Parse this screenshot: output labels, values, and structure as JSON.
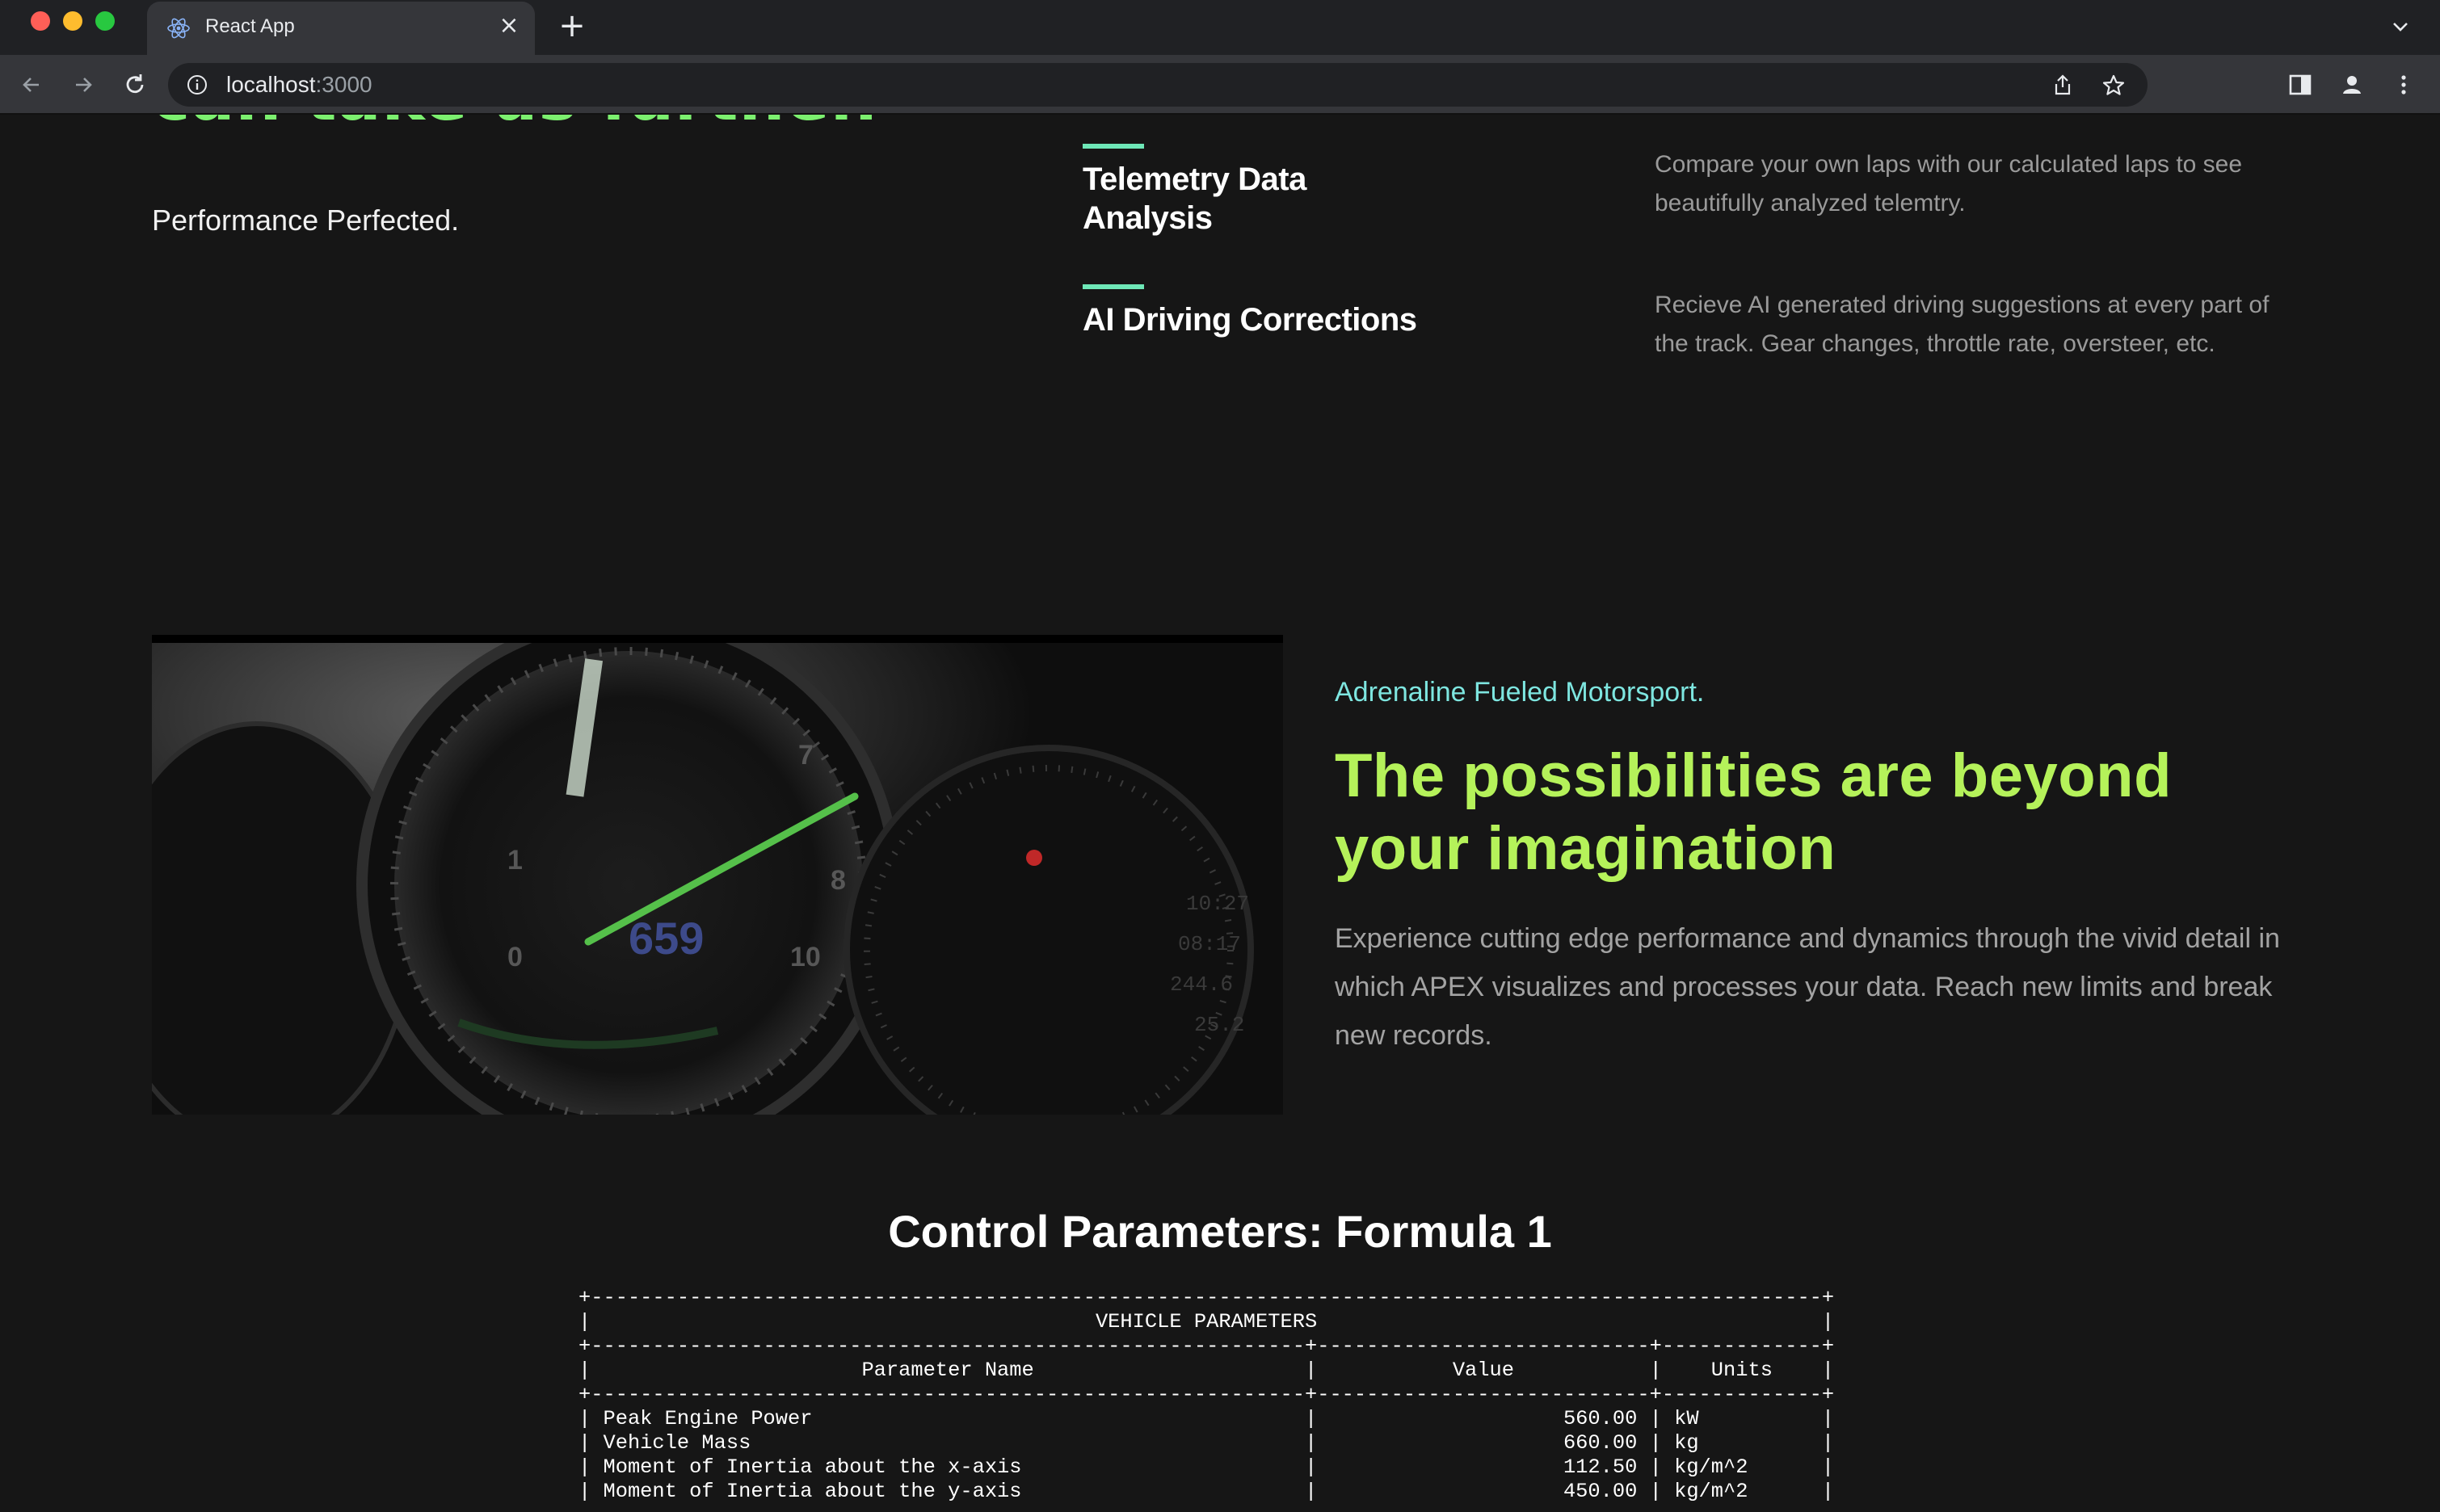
{
  "browser": {
    "tab_title": "React App",
    "url_host": "localhost",
    "url_port": ":3000",
    "icons": {
      "favicon": "react-logo-icon",
      "close": "close-icon",
      "new_tab": "plus-icon",
      "tab_menu": "chevron-down-icon",
      "back": "arrow-left-icon",
      "forward": "arrow-right-icon",
      "reload": "reload-icon",
      "site_info": "info-icon",
      "share": "share-icon",
      "bookmark": "star-icon",
      "side_panel": "side-panel-icon",
      "profile": "profile-icon",
      "menu": "kebab-menu-icon"
    }
  },
  "hero": {
    "cut_heading": "can take us farther.",
    "subtitle": "Performance Perfected."
  },
  "features": [
    {
      "title": "Telemetry Data Analysis",
      "description": "Compare your own laps with our calculated laps to see beautifully analyzed telemtry."
    },
    {
      "title": "AI Driving Corrections",
      "description": "Recieve AI generated driving suggestions at every part of the track. Gear changes, throttle rate, oversteer, etc."
    }
  ],
  "showcase": {
    "kicker": "Adrenaline Fueled Motorsport.",
    "headline": "The possibilities are beyond your imagination",
    "body": "Experience cutting edge performance and dynamics through the vivid detail in which APEX visualizes and processes your data. Reach new limits and break new records.",
    "video_alt": "dashboard-gauge-video"
  },
  "control_parameters": {
    "title": "Control Parameters: Formula 1",
    "table_title": "VEHICLE PARAMETERS",
    "headers": [
      "Parameter Name",
      "Value",
      "Units"
    ],
    "rows": [
      [
        "Peak Engine Power",
        "560.00",
        "kW"
      ],
      [
        "Vehicle Mass",
        "660.00",
        "kg"
      ],
      [
        "Moment of Inertia about the x-axis",
        "112.50",
        "kg/m^2"
      ],
      [
        "Moment of Inertia about the y-axis",
        "450.00",
        "kg/m^2"
      ]
    ]
  },
  "colors": {
    "page_bg": "#161616",
    "accent_green": "#7cf06f",
    "headline_lime": "#b5f25a",
    "kicker_cyan": "#7ee6e0",
    "feature_bar": "#6ee7b7"
  }
}
